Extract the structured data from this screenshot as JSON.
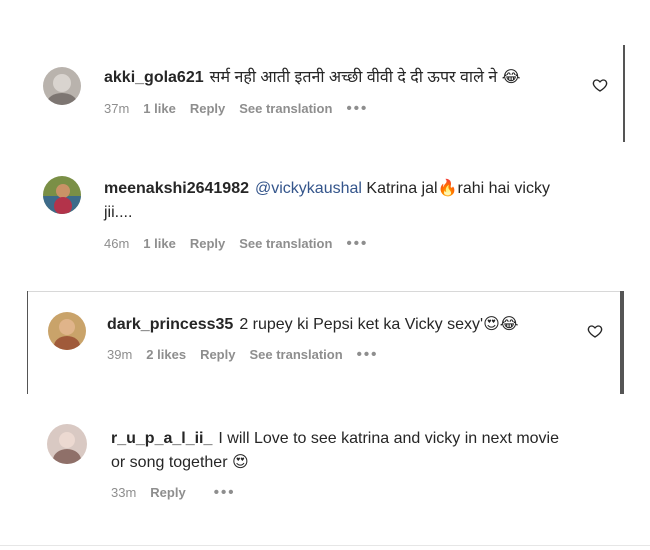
{
  "comments": [
    {
      "username": "akki_gola621",
      "text": "सर्म नही आती इतनी अच्छी वीवी दे दी ऊपर वाले ने",
      "emoji": "😂",
      "time": "37m",
      "likes": "1 like",
      "reply": "Reply",
      "translate": "See translation",
      "more": "•••"
    },
    {
      "username": "meenakshi2641982",
      "mention": "@vickykaushal",
      "text_before": "Katrina jal",
      "emoji": "🔥",
      "text_after": "rahi hai vicky",
      "text_line2": "jii....",
      "time": "46m",
      "likes": "1 like",
      "reply": "Reply",
      "translate": "See translation",
      "more": "•••"
    },
    {
      "username": "dark_princess35",
      "text": "2 rupey ki Pepsi ket ka Vicky sexy'",
      "emoji": "😍😂",
      "time": "39m",
      "likes": "2 likes",
      "reply": "Reply",
      "translate": "See translation",
      "more": "•••"
    },
    {
      "username": "r_u_p_a_l_ii_",
      "text": "I will Love to see katrina and vicky in next movie",
      "text_line2": "or song together",
      "emoji": "😍",
      "time": "33m",
      "reply": "Reply",
      "more": "•••"
    }
  ],
  "colors": {
    "text": "#262626",
    "meta": "#8e8e8e",
    "mention": "#34558b"
  },
  "icons": [
    "heart-outline-icon",
    "more-dots-icon",
    "avatar"
  ]
}
